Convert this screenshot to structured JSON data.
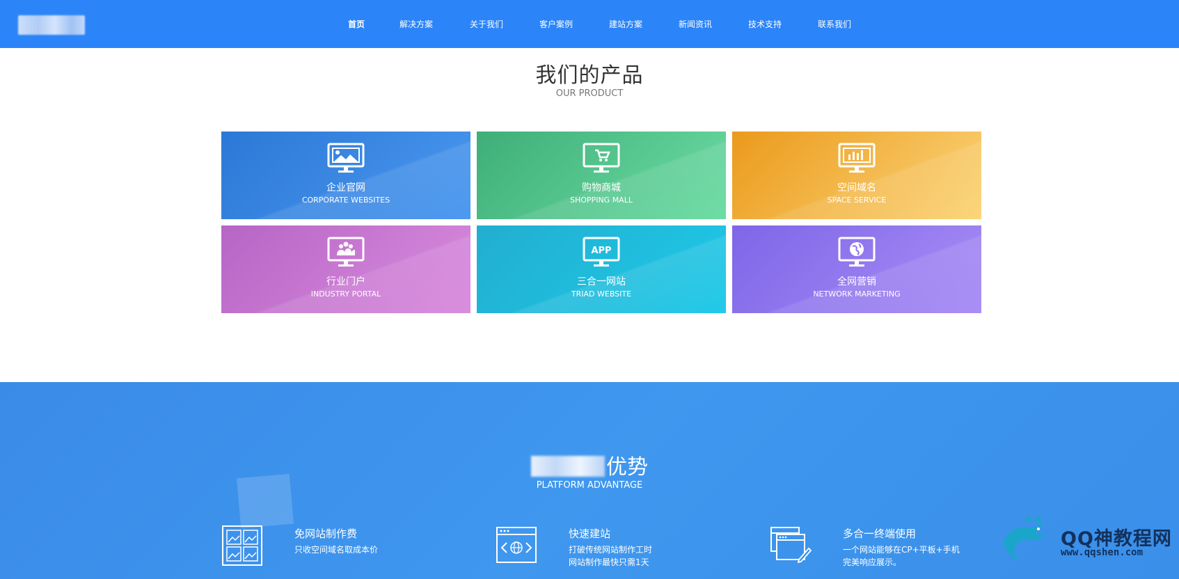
{
  "nav": {
    "items": [
      "首页",
      "解决方案",
      "关于我们",
      "客户案例",
      "建站方案",
      "新闻资讯",
      "技术支持",
      "联系我们"
    ],
    "active": "首页"
  },
  "products": {
    "title": "我们的产品",
    "subtitle": "OUR PRODUCT",
    "cards": [
      {
        "zh": "企业官网",
        "en": "CORPORATE WEBSITES",
        "icon": "monitor-image-icon"
      },
      {
        "zh": "购物商城",
        "en": "SHOPPING MALL",
        "icon": "monitor-cart-icon"
      },
      {
        "zh": "空间域名",
        "en": "SPACE SERVICE",
        "icon": "monitor-bar-chart-icon"
      },
      {
        "zh": "行业门户",
        "en": "INDUSTRY PORTAL",
        "icon": "monitor-users-icon"
      },
      {
        "zh": "三合一网站",
        "en": "TRIAD WEBSITE",
        "icon": "monitor-app-icon"
      },
      {
        "zh": "全网营销",
        "en": "NETWORK MARKETING",
        "icon": "monitor-globe-icon"
      }
    ],
    "app_badge": "APP"
  },
  "advantage": {
    "title_suffix": "优势",
    "subtitle": "PLATFORM ADVANTAGE",
    "features": [
      {
        "title": "免网站制作费",
        "desc": [
          "只收空间域名取成本价"
        ],
        "icon": "image-grid-icon"
      },
      {
        "title": "快速建站",
        "desc": [
          "打破传统网站制作工时",
          "网站制作最快只需1天"
        ],
        "icon": "browser-globe-icon"
      },
      {
        "title": "多合一终端使用",
        "desc": [
          "一个网站能够在CP+平板+手机",
          "完美响应展示。"
        ],
        "icon": "windows-edit-icon"
      }
    ]
  },
  "watermark": {
    "text": "QQ神教程网",
    "url": "www.qqshen.com"
  },
  "colors": {
    "header": "#2b84f8",
    "advantage_bg": "#3a8be8",
    "card_blue": "#2b78d6",
    "card_green": "#3fae78",
    "card_orange": "#eb9a1b",
    "card_pink": "#b765c6",
    "card_cyan": "#22aed0",
    "card_purple": "#7e66e8"
  }
}
